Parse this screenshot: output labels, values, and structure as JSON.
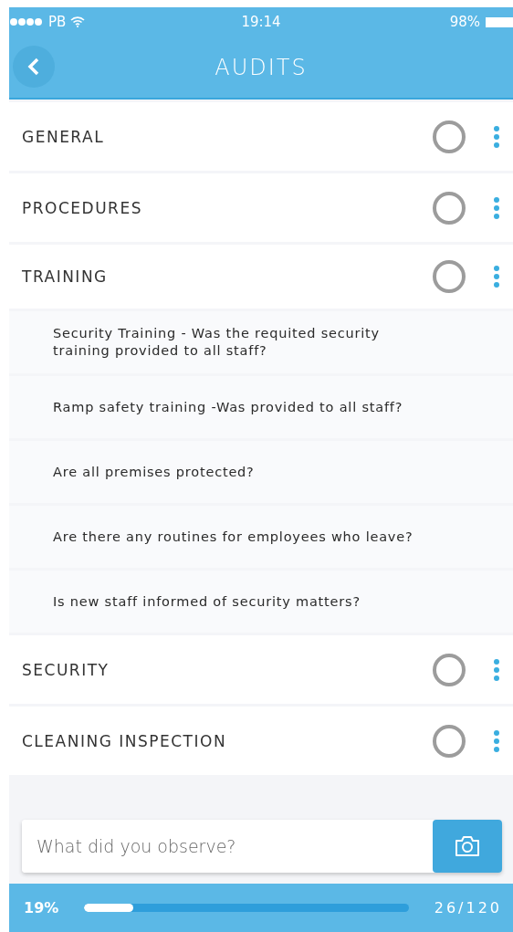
{
  "status_bar": {
    "carrier": "PB",
    "time": "19:14",
    "battery": "98%"
  },
  "nav": {
    "title": "AUDITS"
  },
  "sections": [
    {
      "title": "GENERAL",
      "checked": false,
      "expanded": false
    },
    {
      "title": "PROCEDURES",
      "checked": false,
      "expanded": false
    },
    {
      "title": "TRAINING",
      "checked": false,
      "expanded": true,
      "children": [
        {
          "text": "Security Training - Was the requited security training provided to all staff?"
        },
        {
          "text": "Ramp safety training -Was provided to all staff?"
        },
        {
          "text": "Are all premises protected?"
        },
        {
          "text": "Are there any routines for employees who leave?"
        },
        {
          "text": "Is new staff informed of security matters?"
        }
      ]
    },
    {
      "title": "SECURITY",
      "checked": false,
      "expanded": false
    },
    {
      "title": "CLEANING INSPECTION",
      "checked": false,
      "expanded": false
    }
  ],
  "observation": {
    "placeholder": "What did you observe?"
  },
  "progress": {
    "percent": "19%",
    "level": 0.15,
    "count": "26/120"
  }
}
